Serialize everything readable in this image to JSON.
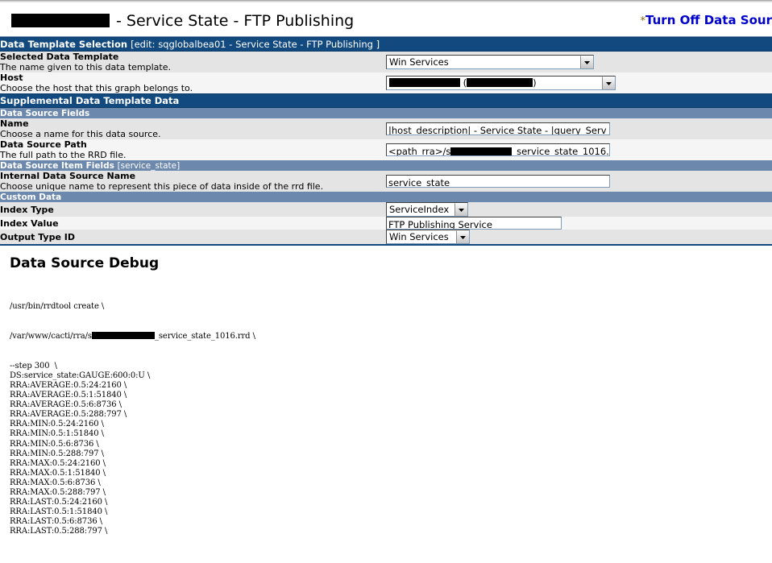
{
  "header": {
    "title_suffix": " - Service State - FTP Publishing",
    "title_redacted_host": "",
    "action_star": "*",
    "action_label": "Turn Off Data Sour"
  },
  "sections": {
    "data_template_selection": {
      "title": "Data Template Selection",
      "subtitle": "[edit: sqglobalbea01 - Service State - FTP Publishing ]",
      "rows": [
        {
          "label": "Selected Data Template",
          "desc": "The name given to this data template.",
          "value": "Win Services"
        },
        {
          "label": "Host",
          "desc": "Choose the host that this graph belongs to.",
          "value_prefix": "",
          "value_paren_open": " (",
          "value_paren_close": ")"
        }
      ]
    },
    "supplemental": {
      "title": "Supplemental Data Template Data",
      "subsections": {
        "data_source_fields": {
          "title": "Data Source Fields",
          "rows": [
            {
              "label": "Name",
              "desc": "Choose a name for this data source.",
              "value": "|host_description| - Service State - |query_Serv"
            },
            {
              "label": "Data Source Path",
              "desc": "The full path to the RRD file.",
              "value_prefix": "<path_rra>/s",
              "value_suffix": "_service_state_1016."
            }
          ]
        },
        "data_source_item_fields": {
          "title": "Data Source Item Fields",
          "subtitle": "[service_state]",
          "rows": [
            {
              "label": "Internal Data Source Name",
              "desc": "Choose unique name to represent this piece of data inside of the rrd file.",
              "value": "service_state"
            }
          ]
        },
        "custom_data": {
          "title": "Custom Data",
          "rows": [
            {
              "label": "Index Type",
              "value": "ServiceIndex"
            },
            {
              "label": "Index Value",
              "value": "FTP Publishing Service"
            },
            {
              "label": "Output Type ID",
              "value": "Win Services"
            }
          ]
        }
      }
    }
  },
  "debug": {
    "heading": "Data Source Debug",
    "line_create": "/usr/bin/rrdtool create \\",
    "line_path_prefix": "/var/www/cacti/rra/s",
    "line_path_suffix": "_service_state_1016.rrd \\",
    "lines": [
      "--step 300  \\",
      "DS:service_state:GAUGE:600:0:U \\",
      "RRA:AVERAGE:0.5:24:2160 \\",
      "RRA:AVERAGE:0.5:1:51840 \\",
      "RRA:AVERAGE:0.5:6:8736 \\",
      "RRA:AVERAGE:0.5:288:797 \\",
      "RRA:MIN:0.5:24:2160 \\",
      "RRA:MIN:0.5:1:51840 \\",
      "RRA:MIN:0.5:6:8736 \\",
      "RRA:MIN:0.5:288:797 \\",
      "RRA:MAX:0.5:24:2160 \\",
      "RRA:MAX:0.5:1:51840 \\",
      "RRA:MAX:0.5:6:8736 \\",
      "RRA:MAX:0.5:288:797 \\",
      "RRA:LAST:0.5:24:2160 \\",
      "RRA:LAST:0.5:1:51840 \\",
      "RRA:LAST:0.5:6:8736 \\",
      "RRA:LAST:0.5:288:797 \\"
    ]
  },
  "colors": {
    "bar_dark": "#12497f",
    "bar_mid": "#6d88ad",
    "link": "#0000cc",
    "row_a": "#e4e4e4",
    "row_b": "#f5f5f5"
  }
}
